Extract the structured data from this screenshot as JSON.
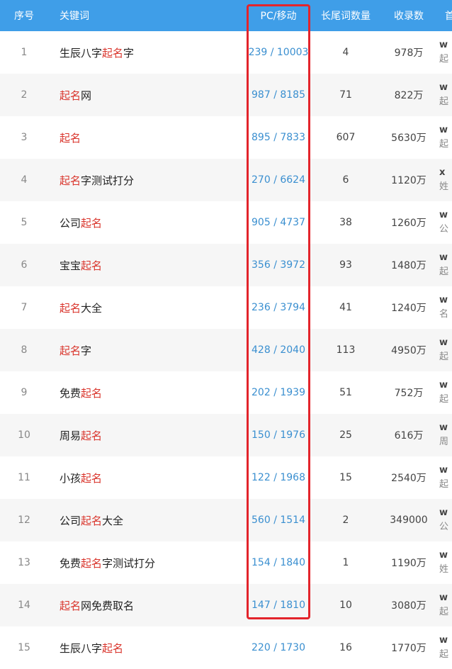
{
  "columns": {
    "seq": "序号",
    "keyword": "关键词",
    "pc_mobile": "PC/移动",
    "longtail": "长尾词数量",
    "indexed": "收录数",
    "first": "首"
  },
  "highlight_term": "起名",
  "highlight_color": "#d9342b",
  "header_color": "#3f9ee8",
  "box_color": "#e3242b",
  "rows": [
    {
      "seq": "1",
      "pre": "生辰八字",
      "hl": "起名",
      "post": "字",
      "pcm": "239 / 10003",
      "longtail": "4",
      "indexed": "978万",
      "f1": "w",
      "f2": "起"
    },
    {
      "seq": "2",
      "pre": "",
      "hl": "起名",
      "post": "网",
      "pcm": "987 / 8185",
      "longtail": "71",
      "indexed": "822万",
      "f1": "w",
      "f2": "起"
    },
    {
      "seq": "3",
      "pre": "",
      "hl": "起名",
      "post": "",
      "pcm": "895 / 7833",
      "longtail": "607",
      "indexed": "5630万",
      "f1": "w",
      "f2": "起"
    },
    {
      "seq": "4",
      "pre": "",
      "hl": "起名",
      "post": "字测试打分",
      "pcm": "270 / 6624",
      "longtail": "6",
      "indexed": "1120万",
      "f1": "x",
      "f2": "姓"
    },
    {
      "seq": "5",
      "pre": "公司",
      "hl": "起名",
      "post": "",
      "pcm": "905 / 4737",
      "longtail": "38",
      "indexed": "1260万",
      "f1": "w",
      "f2": "公"
    },
    {
      "seq": "6",
      "pre": "宝宝",
      "hl": "起名",
      "post": "",
      "pcm": "356 / 3972",
      "longtail": "93",
      "indexed": "1480万",
      "f1": "w",
      "f2": "起"
    },
    {
      "seq": "7",
      "pre": "",
      "hl": "起名",
      "post": "大全",
      "pcm": "236 / 3794",
      "longtail": "41",
      "indexed": "1240万",
      "f1": "w",
      "f2": "名"
    },
    {
      "seq": "8",
      "pre": "",
      "hl": "起名",
      "post": "字",
      "pcm": "428 / 2040",
      "longtail": "113",
      "indexed": "4950万",
      "f1": "w",
      "f2": "起"
    },
    {
      "seq": "9",
      "pre": "免费",
      "hl": "起名",
      "post": "",
      "pcm": "202 / 1939",
      "longtail": "51",
      "indexed": "752万",
      "f1": "w",
      "f2": "起"
    },
    {
      "seq": "10",
      "pre": "周易",
      "hl": "起名",
      "post": "",
      "pcm": "150 / 1976",
      "longtail": "25",
      "indexed": "616万",
      "f1": "w",
      "f2": "周"
    },
    {
      "seq": "11",
      "pre": "小孩",
      "hl": "起名",
      "post": "",
      "pcm": "122 / 1968",
      "longtail": "15",
      "indexed": "2540万",
      "f1": "w",
      "f2": "起"
    },
    {
      "seq": "12",
      "pre": "公司",
      "hl": "起名",
      "post": "大全",
      "pcm": "560 / 1514",
      "longtail": "2",
      "indexed": "349000",
      "f1": "w",
      "f2": "公"
    },
    {
      "seq": "13",
      "pre": "免费",
      "hl": "起名",
      "post": "字测试打分",
      "pcm": "154 / 1840",
      "longtail": "1",
      "indexed": "1190万",
      "f1": "w",
      "f2": "姓"
    },
    {
      "seq": "14",
      "pre": "",
      "hl": "起名",
      "post": "网免费取名",
      "pcm": "147 / 1810",
      "longtail": "10",
      "indexed": "3080万",
      "f1": "w",
      "f2": "起"
    },
    {
      "seq": "15",
      "pre": "生辰八字",
      "hl": "起名",
      "post": "",
      "pcm": "220 / 1730",
      "longtail": "16",
      "indexed": "1770万",
      "f1": "w",
      "f2": "起"
    }
  ]
}
